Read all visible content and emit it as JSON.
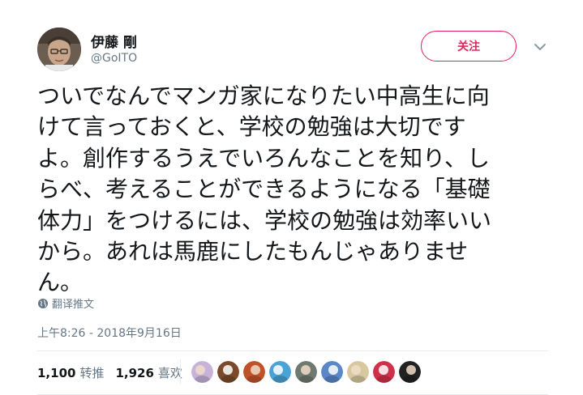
{
  "user": {
    "display_name": "伊藤 剛",
    "handle": "@GoITO"
  },
  "follow_button_label": "关注",
  "tweet": {
    "lines": [
      "ついでなんでマンガ家になりたい中高生に向",
      "けて言っておくと、学校の勉強は大切です",
      "よ。創作するうえでいろんなことを知り、し",
      "らべ、考えることができるようになる「基礎",
      "体力」をつけるには、学校の勉強は効率いい",
      "から。あれは馬鹿にしたもんじゃありませ",
      "ん。"
    ],
    "translate_label": "翻译推文",
    "timestamp": "上午8:26 - 2018年9月16日"
  },
  "stats": {
    "retweets_count": "1,100",
    "retweets_label": "转推",
    "likes_count": "1,926",
    "likes_label": "喜欢"
  },
  "likers": [
    {
      "icon": "liker-avatar-1",
      "color": "#c7b3d9"
    },
    {
      "icon": "liker-avatar-2",
      "color": "#7a4a2a"
    },
    {
      "icon": "liker-avatar-3",
      "color": "#c0522a"
    },
    {
      "icon": "liker-avatar-4",
      "color": "#4aa3d6"
    },
    {
      "icon": "liker-avatar-5",
      "color": "#6e7a70"
    },
    {
      "icon": "liker-avatar-6",
      "color": "#5a87c8"
    },
    {
      "icon": "liker-avatar-7",
      "color": "#d8c8a0"
    },
    {
      "icon": "liker-avatar-8",
      "color": "#d0304a"
    },
    {
      "icon": "liker-avatar-9",
      "color": "#222222"
    }
  ],
  "colors": {
    "accent": "#e0245e",
    "text": "#14171a",
    "muted": "#657786",
    "divider": "#e6ecf0"
  }
}
